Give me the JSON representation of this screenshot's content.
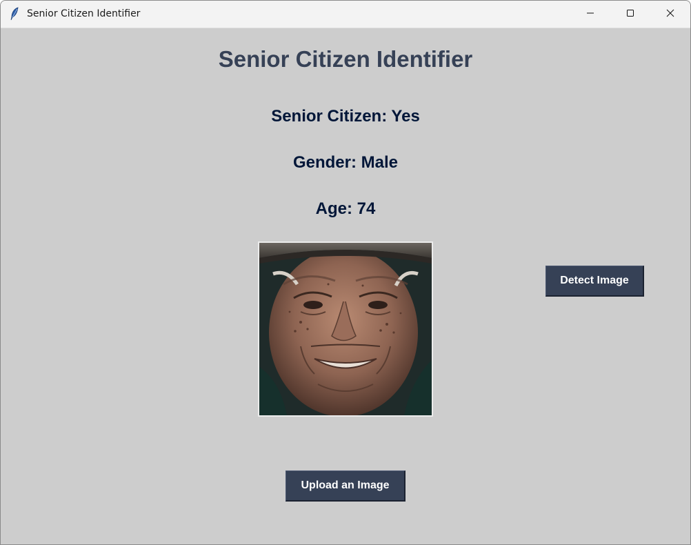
{
  "window": {
    "title": "Senior Citizen Identifier",
    "app_icon": "feather-icon",
    "controls": [
      "minimize-icon",
      "maximize-icon",
      "close-icon"
    ]
  },
  "main": {
    "heading": "Senior Citizen Identifier",
    "results": {
      "senior_citizen": "Senior Citizen: Yes",
      "gender": "Gender: Male",
      "age": "Age: 74"
    },
    "buttons": {
      "detect": "Detect Image",
      "upload": "Upload an Image"
    }
  },
  "colors": {
    "background": "#cdcdcd",
    "heading_text": "#364156",
    "result_text": "#011638",
    "button_bg": "#364156",
    "button_text": "#ffffff"
  }
}
